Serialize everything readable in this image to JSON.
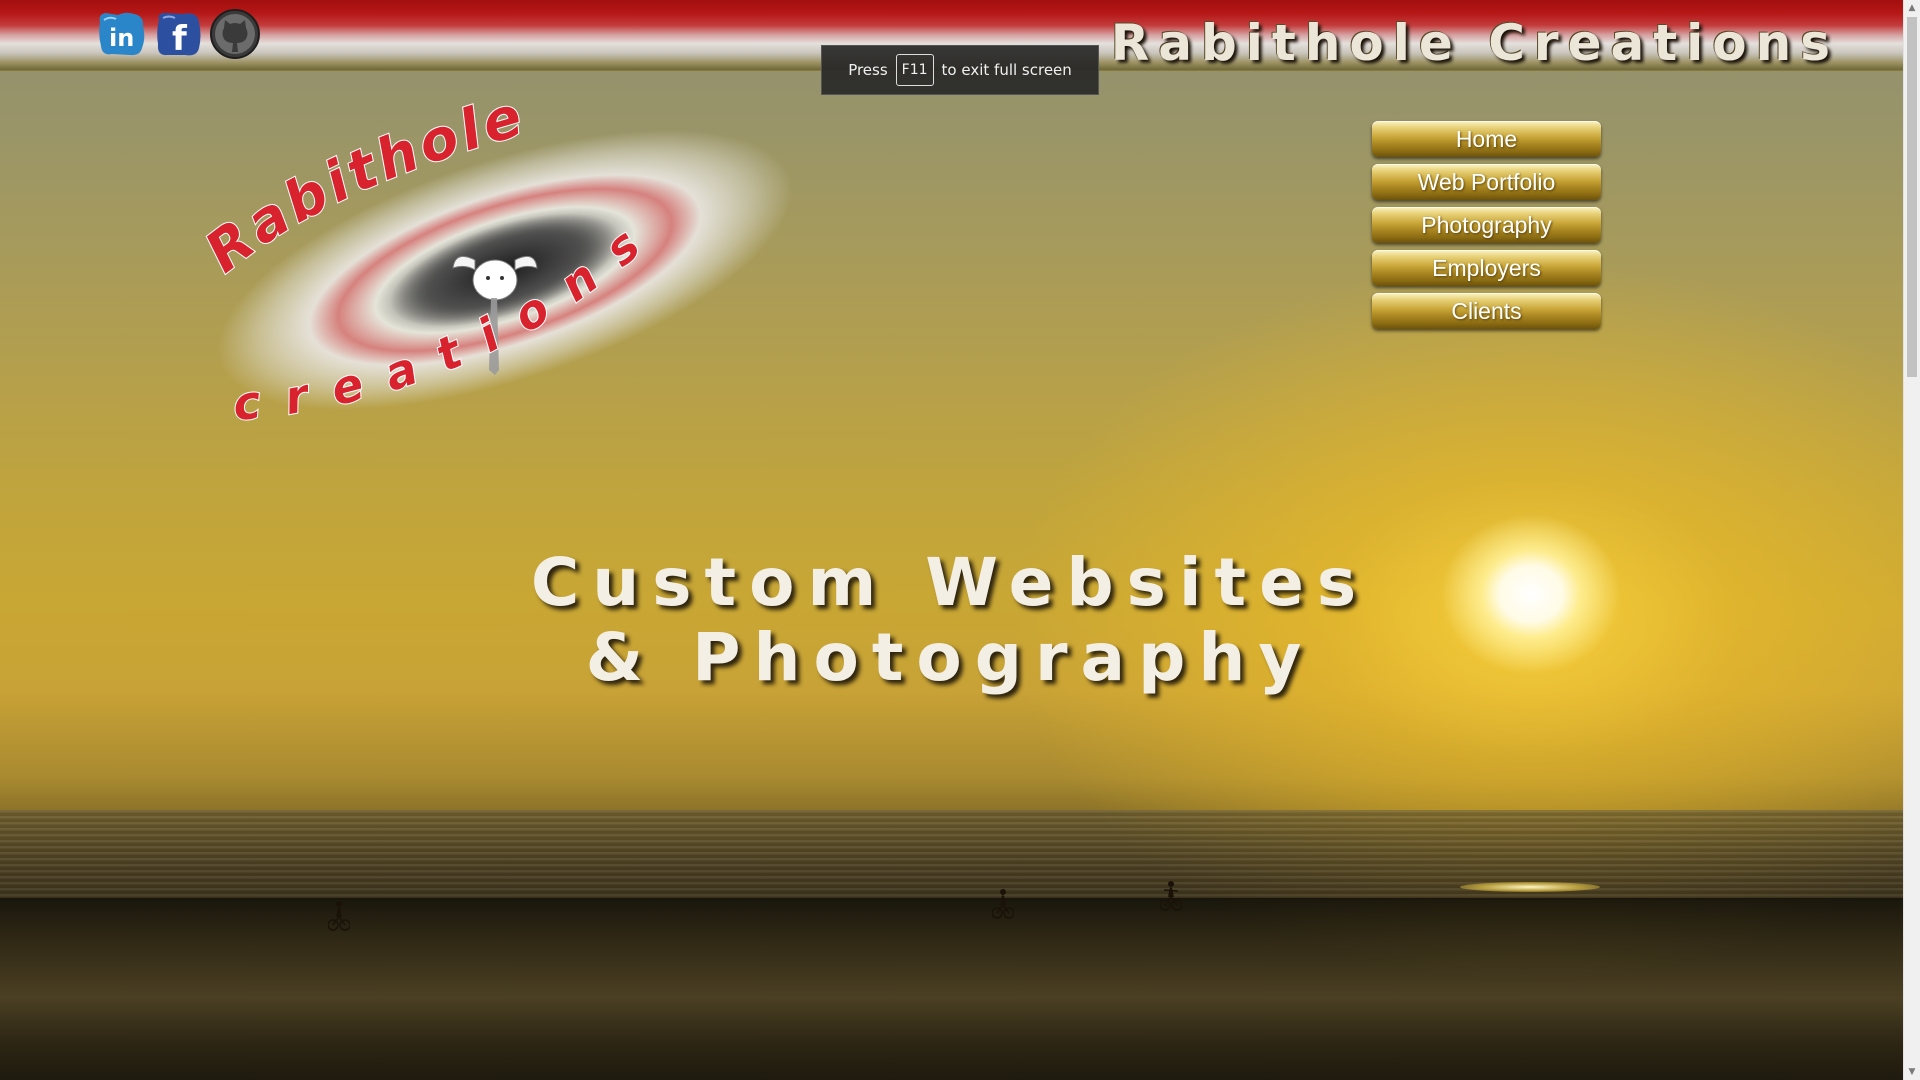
{
  "site": {
    "title": "Rabithole Creations"
  },
  "social": [
    {
      "name": "linkedin-icon",
      "label": "in",
      "color": "#2a86c8"
    },
    {
      "name": "facebook-icon",
      "label": "f",
      "color": "#2c4fa0"
    },
    {
      "name": "github-icon",
      "label": "",
      "color": "#444444"
    }
  ],
  "fullscreen_notice": {
    "prefix": "Press",
    "key": "F11",
    "suffix": "to exit full screen"
  },
  "logo": {
    "top_text": "Rabithole",
    "bottom_text": "creations",
    "accent_color": "#d8232f"
  },
  "nav": {
    "items": [
      {
        "label": "Home"
      },
      {
        "label": "Web Portfolio"
      },
      {
        "label": "Photography"
      },
      {
        "label": "Employers"
      },
      {
        "label": "Clients"
      }
    ]
  },
  "hero": {
    "line1": "Custom Websites",
    "line2": "& Photography"
  },
  "scrollbar": {
    "up_icon": "▲",
    "down_icon": "▼"
  }
}
